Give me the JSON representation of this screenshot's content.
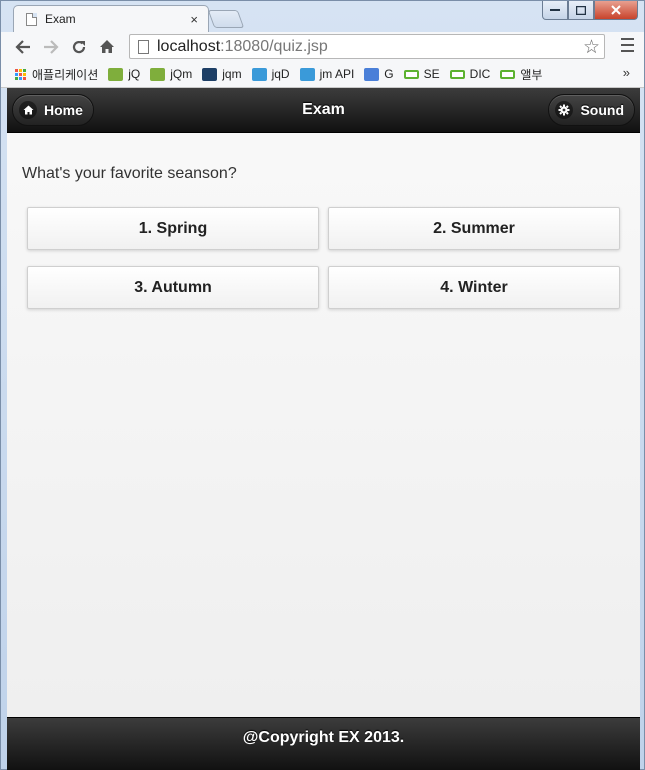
{
  "browser": {
    "tab_title": "Exam",
    "tab_close": "×",
    "url_host": "localhost",
    "url_rest": ":18080/quiz.jsp",
    "bookmarks": [
      {
        "label": "애플리케이션",
        "icon": "apps-grid-icon"
      },
      {
        "label": "jQ",
        "icon": "w3-icon",
        "color": "#7fae3c"
      },
      {
        "label": "jQm",
        "icon": "w3-icon",
        "color": "#7fae3c"
      },
      {
        "label": "jqm",
        "icon": "jqm-icon",
        "color": "#1d3f66"
      },
      {
        "label": "jqD",
        "icon": "puzzle-icon",
        "color": "#3a9ad9"
      },
      {
        "label": "jm API",
        "icon": "puzzle-icon",
        "color": "#3a9ad9"
      },
      {
        "label": "G",
        "icon": "google-icon",
        "color": "#4a7fd8"
      },
      {
        "label": "SE",
        "icon": "box-icon",
        "color": "#5cb230"
      },
      {
        "label": "DIC",
        "icon": "box-icon",
        "color": "#5cb230"
      },
      {
        "label": "앨부",
        "icon": "box-icon",
        "color": "#5cb230"
      }
    ],
    "more": "»"
  },
  "header": {
    "title": "Exam",
    "home_label": "Home",
    "sound_label": "Sound"
  },
  "quiz": {
    "question": "What's your favorite seanson?",
    "answers": [
      "1. Spring",
      "2. Summer",
      "3. Autumn",
      "4. Winter"
    ]
  },
  "footer": {
    "text": "@Copyright EX 2013."
  }
}
